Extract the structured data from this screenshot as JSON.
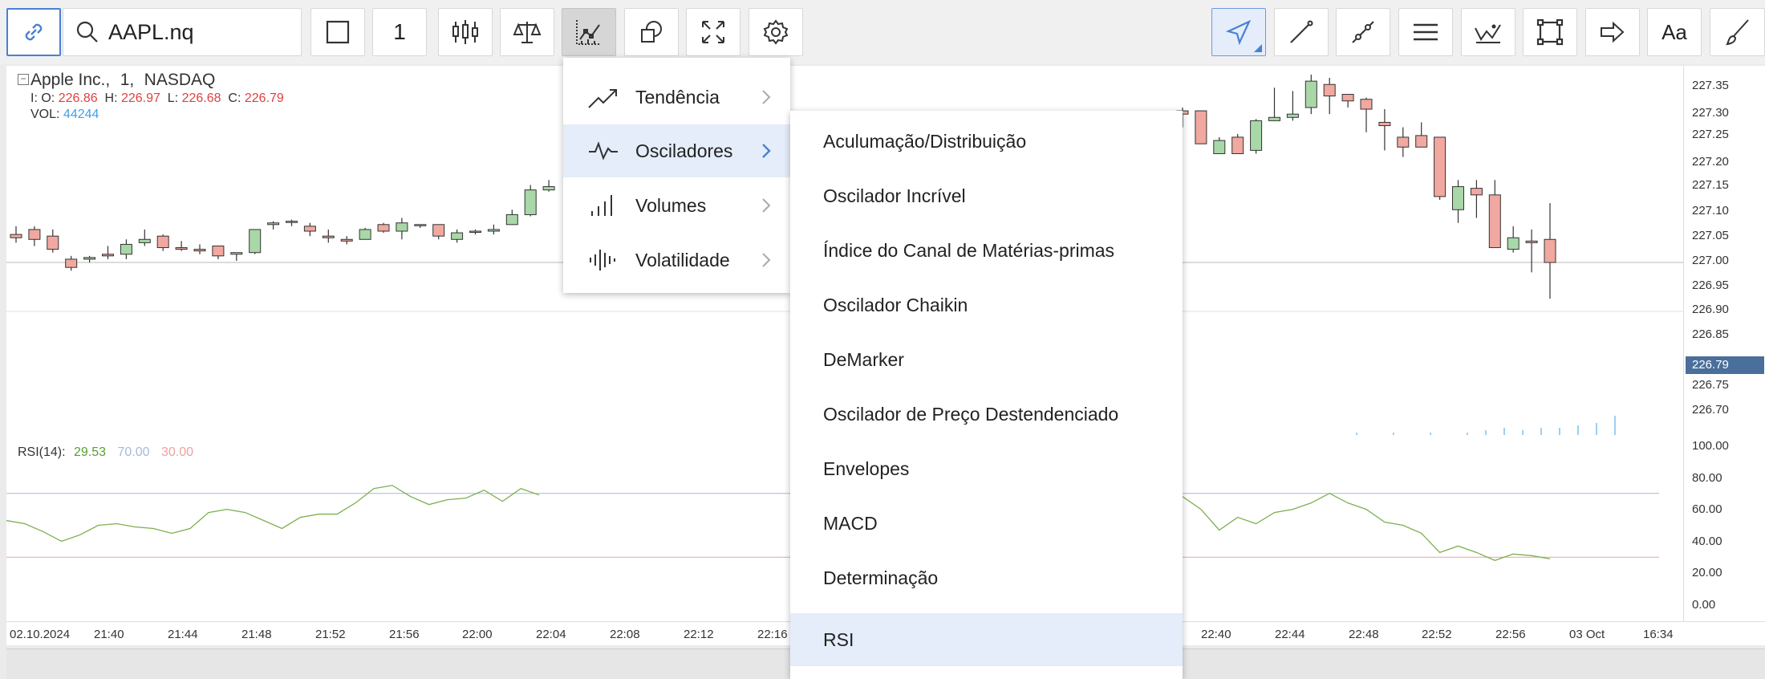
{
  "toolbar": {
    "symbol_value": "AAPL.nq",
    "interval_label": "1",
    "left_buttons": [
      {
        "name": "link-button",
        "icon": "link-icon"
      },
      {
        "name": "chart-frame-button",
        "icon": "square-icon"
      },
      {
        "name": "chart-type-button",
        "icon": "candlestick-icon"
      },
      {
        "name": "compare-button",
        "icon": "scales-icon"
      },
      {
        "name": "indicators-button",
        "icon": "indicator-chart-icon"
      },
      {
        "name": "objects-button",
        "icon": "shapes-icon"
      },
      {
        "name": "fullscreen-button",
        "icon": "expand-icon"
      },
      {
        "name": "settings-button",
        "icon": "gear-icon"
      }
    ],
    "right_tools": [
      "cursor-icon",
      "line-icon",
      "segment-icon",
      "horizontal-lines-icon",
      "wave-icon",
      "rectangle-icon",
      "arrow-icon",
      "text-icon",
      "brush-icon"
    ],
    "text_tool_label": "Aa"
  },
  "chart": {
    "title": "Apple Inc.,",
    "interval": "1,",
    "exchange": "NASDAQ",
    "ohlc": {
      "o_label": "I: O:",
      "o": "226.86",
      "h_label": "H:",
      "h": "226.97",
      "l_label": "L:",
      "l": "226.68",
      "c_label": "C:",
      "c": "226.79"
    },
    "vol_label": "VOL:",
    "vol": "44244",
    "last_price": "226.79",
    "rsi": {
      "label": "RSI(14):",
      "value": "29.53",
      "overbought": "70.00",
      "oversold": "30.00"
    },
    "price_ticks": [
      "227.35",
      "227.30",
      "227.25",
      "227.20",
      "227.15",
      "227.10",
      "227.05",
      "227.00",
      "226.95",
      "226.90",
      "226.85",
      "226.79",
      "226.75",
      "226.70"
    ],
    "rsi_ticks": [
      "100.00",
      "80.00",
      "60.00",
      "40.00",
      "20.00",
      "0.00"
    ],
    "time_ticks": [
      "02.10.2024",
      "21:40",
      "21:44",
      "21:48",
      "21:52",
      "21:56",
      "22:00",
      "22:04",
      "22:08",
      "22:12",
      "22:16",
      "22:40",
      "22:44",
      "22:48",
      "22:52",
      "22:56",
      "03 Oct",
      "16:34"
    ],
    "colors": {
      "up": "#a8d8a8",
      "down": "#f0a8a0",
      "wick": "#333333",
      "rsi_line": "#7cb050",
      "overbought": "#a8b8d8",
      "oversold": "#f0a0a0",
      "price_tag": "#4a6f9a"
    }
  },
  "chart_data": {
    "type": "candlestick",
    "candles_left": [
      {
        "o": 226.875,
        "h": 226.9,
        "l": 226.85,
        "c": 226.865
      },
      {
        "o": 226.89,
        "h": 226.9,
        "l": 226.84,
        "c": 226.86
      },
      {
        "o": 226.87,
        "h": 226.89,
        "l": 226.82,
        "c": 226.83
      },
      {
        "o": 226.8,
        "h": 226.81,
        "l": 226.765,
        "c": 226.775
      },
      {
        "o": 226.8,
        "h": 226.81,
        "l": 226.79,
        "c": 226.805
      },
      {
        "o": 226.815,
        "h": 226.84,
        "l": 226.8,
        "c": 226.81
      },
      {
        "o": 226.815,
        "h": 226.86,
        "l": 226.8,
        "c": 226.845
      },
      {
        "o": 226.85,
        "h": 226.89,
        "l": 226.84,
        "c": 226.86
      },
      {
        "o": 226.87,
        "h": 226.875,
        "l": 226.825,
        "c": 226.835
      },
      {
        "o": 226.835,
        "h": 226.855,
        "l": 226.825,
        "c": 226.83
      },
      {
        "o": 226.83,
        "h": 226.845,
        "l": 226.815,
        "c": 226.825
      },
      {
        "o": 226.84,
        "h": 226.84,
        "l": 226.8,
        "c": 226.81
      },
      {
        "o": 226.815,
        "h": 226.82,
        "l": 226.795,
        "c": 226.82
      },
      {
        "o": 226.82,
        "h": 226.89,
        "l": 226.815,
        "c": 226.89
      },
      {
        "o": 226.905,
        "h": 226.915,
        "l": 226.89,
        "c": 226.91
      },
      {
        "o": 226.915,
        "h": 226.92,
        "l": 226.9,
        "c": 226.915
      },
      {
        "o": 226.9,
        "h": 226.91,
        "l": 226.87,
        "c": 226.885
      },
      {
        "o": 226.87,
        "h": 226.89,
        "l": 226.85,
        "c": 226.865
      },
      {
        "o": 226.86,
        "h": 226.87,
        "l": 226.845,
        "c": 226.855
      },
      {
        "o": 226.86,
        "h": 226.895,
        "l": 226.86,
        "c": 226.89
      },
      {
        "o": 226.905,
        "h": 226.91,
        "l": 226.88,
        "c": 226.885
      },
      {
        "o": 226.885,
        "h": 226.925,
        "l": 226.86,
        "c": 226.91
      },
      {
        "o": 226.905,
        "h": 226.905,
        "l": 226.895,
        "c": 226.905
      },
      {
        "o": 226.905,
        "h": 226.905,
        "l": 226.86,
        "c": 226.87
      },
      {
        "o": 226.86,
        "h": 226.89,
        "l": 226.85,
        "c": 226.88
      },
      {
        "o": 226.885,
        "h": 226.89,
        "l": 226.875,
        "c": 226.885
      },
      {
        "o": 226.885,
        "h": 226.905,
        "l": 226.875,
        "c": 226.89
      },
      {
        "o": 226.905,
        "h": 226.95,
        "l": 226.905,
        "c": 226.935
      },
      {
        "o": 226.935,
        "h": 227.025,
        "l": 226.93,
        "c": 227.01
      },
      {
        "o": 227.01,
        "h": 227.04,
        "l": 227.005,
        "c": 227.02
      }
    ],
    "candles_right": [
      {
        "o": 227.25,
        "h": 227.26,
        "l": 227.2,
        "c": 227.24
      },
      {
        "o": 227.25,
        "h": 227.25,
        "l": 227.15,
        "c": 227.15
      },
      {
        "o": 227.12,
        "h": 227.17,
        "l": 227.12,
        "c": 227.16
      },
      {
        "o": 227.17,
        "h": 227.18,
        "l": 227.12,
        "c": 227.12
      },
      {
        "o": 227.13,
        "h": 227.225,
        "l": 227.12,
        "c": 227.22
      },
      {
        "o": 227.22,
        "h": 227.32,
        "l": 227.22,
        "c": 227.23
      },
      {
        "o": 227.23,
        "h": 227.31,
        "l": 227.22,
        "c": 227.24
      },
      {
        "o": 227.26,
        "h": 227.36,
        "l": 227.24,
        "c": 227.34
      },
      {
        "o": 227.33,
        "h": 227.35,
        "l": 227.24,
        "c": 227.295
      },
      {
        "o": 227.3,
        "h": 227.3,
        "l": 227.26,
        "c": 227.28
      },
      {
        "o": 227.285,
        "h": 227.29,
        "l": 227.185,
        "c": 227.255
      },
      {
        "o": 227.215,
        "h": 227.255,
        "l": 227.13,
        "c": 227.205
      },
      {
        "o": 227.17,
        "h": 227.2,
        "l": 227.11,
        "c": 227.14
      },
      {
        "o": 227.175,
        "h": 227.215,
        "l": 227.14,
        "c": 227.14
      },
      {
        "o": 227.17,
        "h": 227.17,
        "l": 226.98,
        "c": 226.99
      },
      {
        "o": 226.95,
        "h": 227.04,
        "l": 226.91,
        "c": 227.02
      },
      {
        "o": 227.015,
        "h": 227.04,
        "l": 226.925,
        "c": 226.995
      },
      {
        "o": 226.995,
        "h": 227.04,
        "l": 226.84,
        "c": 226.835
      },
      {
        "o": 226.83,
        "h": 226.9,
        "l": 226.82,
        "c": 226.865
      },
      {
        "o": 226.855,
        "h": 226.89,
        "l": 226.76,
        "c": 226.85
      },
      {
        "o": 226.86,
        "h": 226.97,
        "l": 226.68,
        "c": 226.79
      }
    ],
    "rsi_left": [
      53,
      51,
      46,
      40,
      44,
      50,
      51,
      49,
      48,
      45,
      48,
      58,
      60,
      58,
      53,
      48,
      55,
      57,
      57,
      64,
      73,
      75,
      68,
      63,
      66,
      67,
      72,
      65,
      73,
      69
    ],
    "rsi_right": [
      68,
      60,
      47,
      55,
      51,
      58,
      60,
      64,
      70,
      64,
      60,
      52,
      50,
      45,
      33,
      37,
      33,
      28,
      32,
      31,
      29
    ],
    "overbought": 70,
    "oversold": 30,
    "volume_right": [
      0,
      0,
      0,
      0,
      0,
      0,
      0,
      0,
      0,
      0,
      0,
      0,
      0,
      0,
      0,
      0,
      0,
      0,
      0,
      0,
      0,
      1,
      0,
      1,
      0,
      1,
      0,
      1,
      2,
      3,
      2,
      3,
      3,
      4,
      5,
      8
    ]
  },
  "menus": {
    "categories": [
      {
        "label": "Tendência",
        "icon": "trend-icon"
      },
      {
        "label": "Osciladores",
        "icon": "oscillator-icon",
        "active": true
      },
      {
        "label": "Volumes",
        "icon": "volume-bars-icon"
      },
      {
        "label": "Volatilidade",
        "icon": "volatility-icon"
      }
    ],
    "oscillators": [
      "Aculumação/Distribuição",
      "Oscilador Incrível",
      "Índice do Canal de Matérias-primas",
      "Oscilador Chaikin",
      "DeMarker",
      "Oscilador de Preço Destendenciado",
      "Envelopes",
      "MACD",
      "Determinação",
      "RSI"
    ],
    "highlighted_oscillator": "RSI"
  }
}
